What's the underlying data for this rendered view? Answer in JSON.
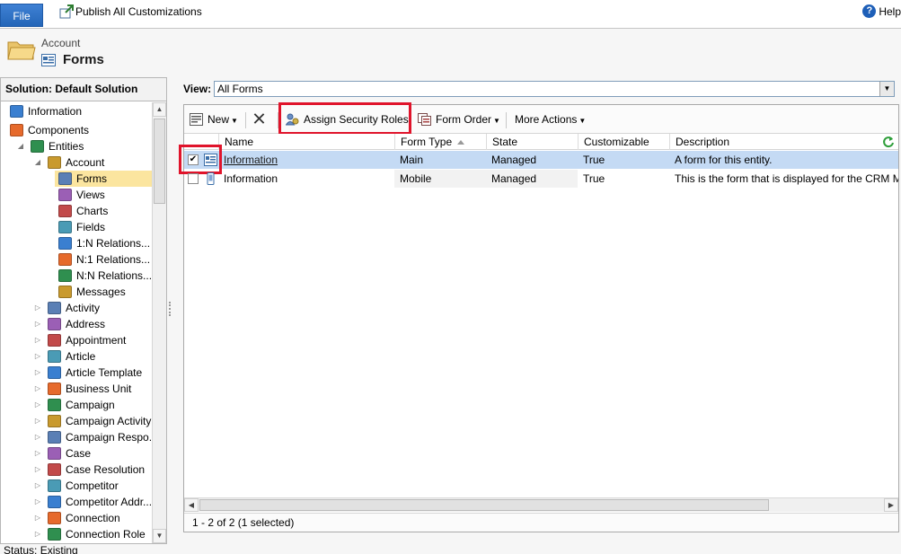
{
  "ribbon": {
    "file_label": "File",
    "publish_label": "Publish All Customizations",
    "help_label": "Help"
  },
  "header": {
    "entity_name": "Account",
    "page_title": "Forms"
  },
  "leftnav": {
    "solution_title": "Solution: Default Solution",
    "items": [
      {
        "label": "Information",
        "icon": "information-icon"
      },
      {
        "label": "Components",
        "icon": "components-icon"
      },
      {
        "label": "Entities",
        "icon": "entities-icon"
      },
      {
        "label": "Account",
        "icon": "folder-icon"
      },
      {
        "label": "Forms",
        "icon": "forms-icon"
      },
      {
        "label": "Views",
        "icon": "views-icon"
      },
      {
        "label": "Charts",
        "icon": "charts-icon"
      },
      {
        "label": "Fields",
        "icon": "fields-icon"
      },
      {
        "label": "1:N Relations...",
        "icon": "relationship-icon"
      },
      {
        "label": "N:1 Relations...",
        "icon": "relationship-icon"
      },
      {
        "label": "N:N Relations...",
        "icon": "relationship-icon"
      },
      {
        "label": "Messages",
        "icon": "messages-icon"
      },
      {
        "label": "Activity",
        "icon": "activity-icon"
      },
      {
        "label": "Address",
        "icon": "address-icon"
      },
      {
        "label": "Appointment",
        "icon": "appointment-icon"
      },
      {
        "label": "Article",
        "icon": "article-icon"
      },
      {
        "label": "Article Template",
        "icon": "article-template-icon"
      },
      {
        "label": "Business Unit",
        "icon": "business-unit-icon"
      },
      {
        "label": "Campaign",
        "icon": "campaign-icon"
      },
      {
        "label": "Campaign Activity",
        "icon": "campaign-activity-icon"
      },
      {
        "label": "Campaign Respo...",
        "icon": "campaign-response-icon"
      },
      {
        "label": "Case",
        "icon": "case-icon"
      },
      {
        "label": "Case Resolution",
        "icon": "case-resolution-icon"
      },
      {
        "label": "Competitor",
        "icon": "competitor-icon"
      },
      {
        "label": "Competitor Addr...",
        "icon": "competitor-address-icon"
      },
      {
        "label": "Connection",
        "icon": "connection-icon"
      },
      {
        "label": "Connection Role",
        "icon": "connection-role-icon"
      }
    ]
  },
  "view": {
    "label": "View:",
    "selected": "All Forms"
  },
  "toolbar": {
    "new_label": "New",
    "assign_label": "Assign Security Roles",
    "form_order_label": "Form Order",
    "more_actions_label": "More Actions"
  },
  "grid": {
    "columns": [
      "Name",
      "Form Type",
      "State",
      "Customizable",
      "Description"
    ],
    "rows": [
      {
        "checked": "✔",
        "name": "Information",
        "form_type": "Main",
        "state": "Managed",
        "customizable": "True",
        "description": "A form for this entity."
      },
      {
        "checked": "",
        "name": "Information",
        "form_type": "Mobile",
        "state": "Managed",
        "customizable": "True",
        "description": "This is the form that is displayed for the CRM M"
      }
    ],
    "footer": "1 - 2 of 2 (1 selected)"
  },
  "status": {
    "text": "Status: Existing"
  },
  "colors": {
    "selected_row": "#c4daf4",
    "selected_nav": "#fbe59f",
    "highlight_box": "#e0142b",
    "file_button": "#2466b8"
  }
}
